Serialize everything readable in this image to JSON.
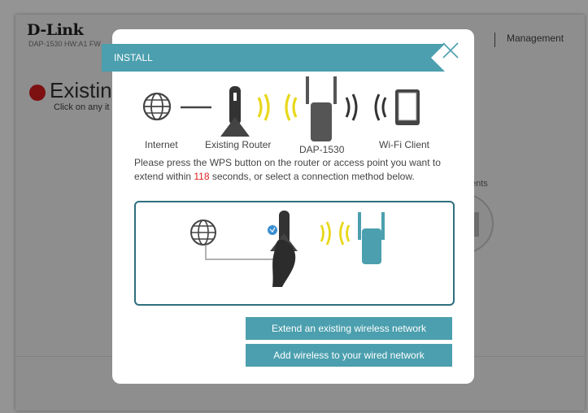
{
  "page": {
    "logo": "D-Link",
    "model_line": "DAP-1530  HW:A1  FW",
    "nav_management": "Management",
    "heading": "Existin",
    "subtext": "Click on any it",
    "clients_fragment": "ents"
  },
  "modal": {
    "title": "INSTALL",
    "labels": {
      "internet": "Internet",
      "existing_router": "Existing Router",
      "device": "DAP-1530",
      "wifi_client": "Wi-Fi Client"
    },
    "instruction_part1": "Please press the WPS button on the router or access point you want to extend within ",
    "countdown_seconds": "118",
    "instruction_part2": " seconds, or select a connection method below.",
    "buttons": {
      "extend_wireless": "Extend an existing wireless network",
      "add_wireless": "Add wireless to your wired network"
    }
  },
  "colors": {
    "teal_header": "#4b9fae",
    "teal_dark": "#2f6f7d",
    "signal_yellow": "#e8d81c",
    "status_red": "#d81e1e",
    "countdown_red": "#e02020"
  }
}
